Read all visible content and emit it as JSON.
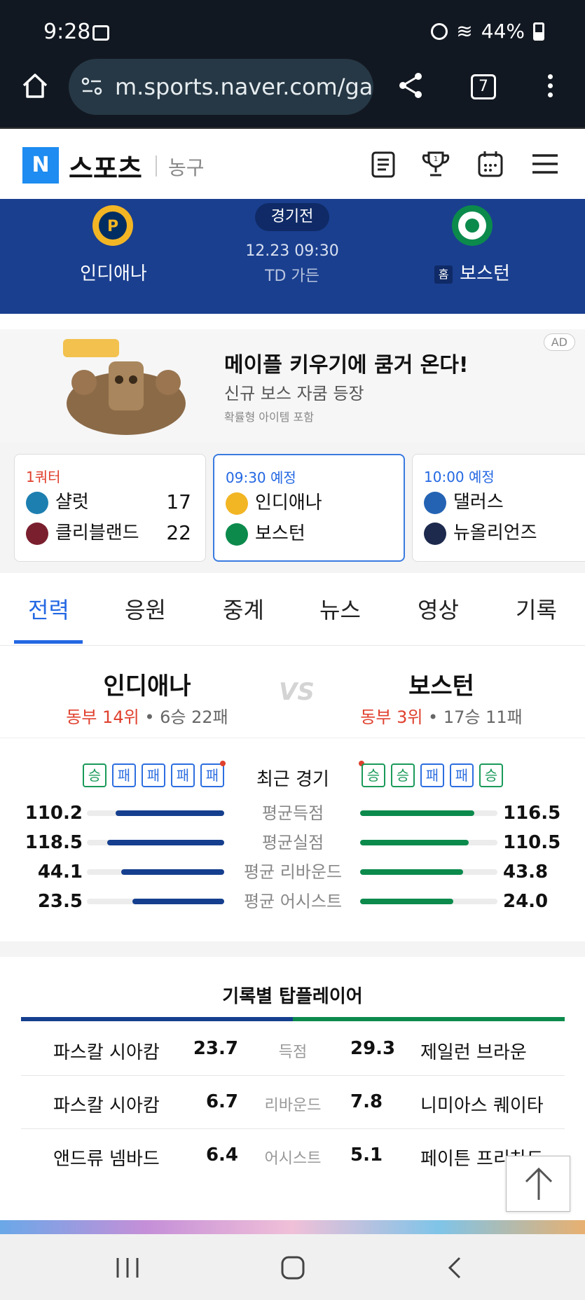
{
  "status_bar": {
    "time": "9:28",
    "battery": "44%"
  },
  "browser": {
    "url": "m.sports.naver.com/ga",
    "tab_count": "7"
  },
  "naver_header": {
    "logo": "N",
    "title": "스포츠",
    "category": "농구"
  },
  "game": {
    "away": {
      "name": "인디애나"
    },
    "home": {
      "name": "보스턴",
      "badge": "홈"
    },
    "status": "경기전",
    "datetime": "12.23 09:30",
    "venue": "TD 가든"
  },
  "ad": {
    "title": "메이플 키우기에 쿰거 온다!",
    "subtitle": "신규 보스 자쿰 등장",
    "note": "확률형 아이템 포함",
    "badge": "AD"
  },
  "scoreboard": [
    {
      "status": "1쿼터",
      "status_color": "#e0402e",
      "teams": [
        {
          "name": "샬럿",
          "score": "17",
          "color": "#1d7fb0"
        },
        {
          "name": "클리블랜드",
          "score": "22",
          "color": "#7a1f2e"
        }
      ]
    },
    {
      "status": "09:30 예정",
      "status_color": "#2468e3",
      "teams": [
        {
          "name": "인디애나",
          "score": "",
          "color": "#f2b524"
        },
        {
          "name": "보스턴",
          "score": "",
          "color": "#0b8a4c"
        }
      ]
    },
    {
      "status": "10:00 예정",
      "status_color": "#2468e3",
      "teams": [
        {
          "name": "댈러스",
          "score": "",
          "color": "#2463b4"
        },
        {
          "name": "뉴올리언즈",
          "score": "",
          "color": "#1d2a4e"
        }
      ]
    }
  ],
  "tabs": [
    "전력",
    "응원",
    "중계",
    "뉴스",
    "영상",
    "기록"
  ],
  "versus": {
    "left": {
      "name": "인디애나",
      "rank": "동부 14위",
      "record": "6승 22패"
    },
    "right": {
      "name": "보스턴",
      "rank": "동부 3위",
      "record": "17승 11패"
    },
    "mark": "VS"
  },
  "recent": {
    "label": "최근 경기",
    "left": [
      "승",
      "패",
      "패",
      "패",
      "패"
    ],
    "right": [
      "승",
      "승",
      "패",
      "패",
      "승"
    ]
  },
  "stats": [
    {
      "label": "평균득점",
      "left": "110.2",
      "right": "116.5",
      "left_fill": 0.79,
      "right_fill": 0.83
    },
    {
      "label": "평균실점",
      "left": "118.5",
      "right": "110.5",
      "left_fill": 0.85,
      "right_fill": 0.79
    },
    {
      "label": "평균 리바운드",
      "left": "44.1",
      "right": "43.8",
      "left_fill": 0.75,
      "right_fill": 0.75
    },
    {
      "label": "평균 어시스트",
      "left": "23.5",
      "right": "24.0",
      "left_fill": 0.67,
      "right_fill": 0.68
    }
  ],
  "top_players": {
    "title": "기록별 탑플레이어",
    "rows": [
      {
        "category": "득점",
        "left_name": "파스칼 시아캄",
        "left_value": "23.7",
        "right_value": "29.3",
        "right_name": "제일런 브라운"
      },
      {
        "category": "리바운드",
        "left_name": "파스칼 시아캄",
        "left_value": "6.7",
        "right_value": "7.8",
        "right_name": "니미아스 퀘이타"
      },
      {
        "category": "어시스트",
        "left_name": "앤드류 넴바드",
        "left_value": "6.4",
        "right_value": "5.1",
        "right_name": "페이튼 프리차드"
      }
    ]
  },
  "colors": {
    "away": "#153f8e",
    "home": "#0b8a4c",
    "accent": "#2468e3",
    "header_bg": "#1a3f8f"
  }
}
